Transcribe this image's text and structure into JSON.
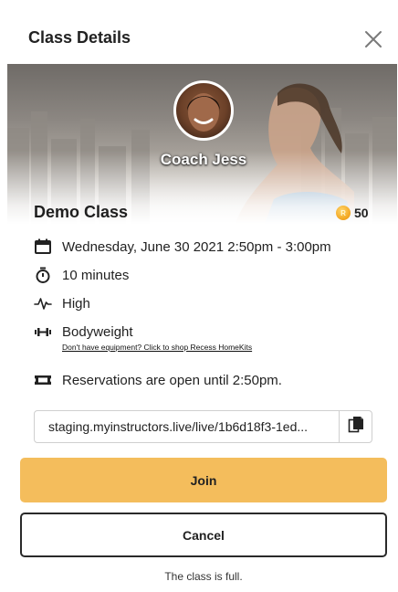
{
  "dialog": {
    "title": "Class Details",
    "close_icon": "close-icon"
  },
  "hero": {
    "coach_name": "Coach Jess"
  },
  "class": {
    "name": "Demo Class",
    "points": "50",
    "coin_symbol": "R",
    "coin_icon": "coin-icon"
  },
  "details": {
    "datetime": "Wednesday, June 30 2021 2:50pm - 3:00pm",
    "duration": "10 minutes",
    "intensity": "High",
    "equipment": "Bodyweight",
    "equipment_link": "Don't have equipment? Click to shop Recess HomeKits",
    "reservation": "Reservations are open until 2:50pm."
  },
  "icons": {
    "datetime": "calendar-icon",
    "duration": "stopwatch-icon",
    "intensity": "heartbeat-icon",
    "equipment": "dumbbell-icon",
    "reservation": "ticket-icon",
    "copy": "copy-icon"
  },
  "link": {
    "url": "staging.myinstructors.live/live/1b6d18f3-1ed..."
  },
  "actions": {
    "join_label": "Join",
    "cancel_label": "Cancel"
  },
  "status": {
    "note": "The class is full."
  },
  "colors": {
    "join_bg": "#f4bd5c",
    "cancel_border": "#2a2a2a",
    "coin": "#f2a41e"
  }
}
